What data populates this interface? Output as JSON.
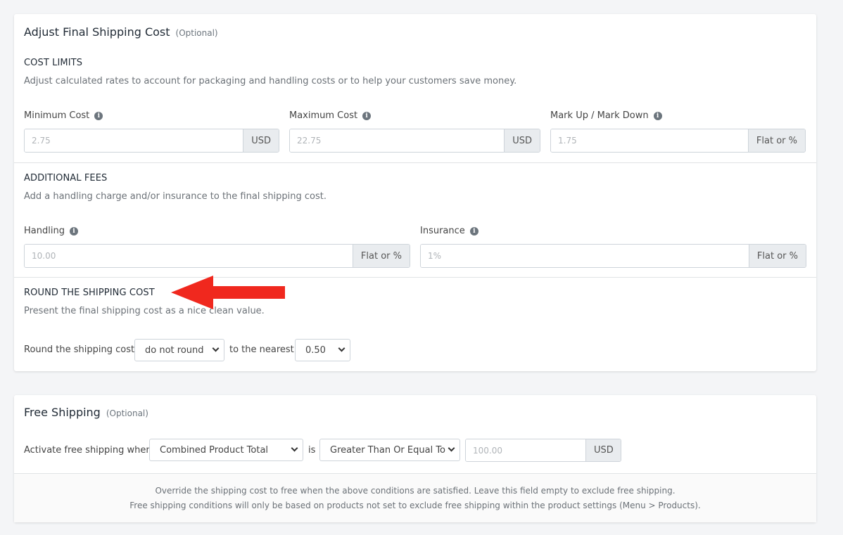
{
  "adjust": {
    "title": "Adjust Final Shipping Cost",
    "optional": "(Optional)",
    "cost_limits": {
      "heading": "COST LIMITS",
      "description": "Adjust calculated rates to account for packaging and handling costs or to help your customers save money.",
      "min": {
        "label": "Minimum Cost",
        "placeholder": "2.75",
        "addon": "USD"
      },
      "max": {
        "label": "Maximum Cost",
        "placeholder": "22.75",
        "addon": "USD"
      },
      "markup": {
        "label": "Mark Up / Mark Down",
        "placeholder": "1.75",
        "addon": "Flat or %"
      }
    },
    "fees": {
      "heading": "ADDITIONAL FEES",
      "description": "Add a handling charge and/or insurance to the final shipping cost.",
      "handling": {
        "label": "Handling",
        "placeholder": "10.00",
        "addon": "Flat or %"
      },
      "insurance": {
        "label": "Insurance",
        "placeholder": "1%",
        "addon": "Flat or %"
      }
    },
    "round": {
      "heading": "ROUND THE SHIPPING COST",
      "description": "Present the final shipping cost as a nice clean value.",
      "label": "Round the shipping cost",
      "mode": "do not round",
      "nearest_label": "to the nearest",
      "nearest": "0.50"
    }
  },
  "free": {
    "title": "Free Shipping",
    "optional": "(Optional)",
    "activate_label": "Activate free shipping when",
    "condition": "Combined Product Total",
    "is_label": "is",
    "operator": "Greater Than Or Equal To",
    "amount_placeholder": "100.00",
    "amount_addon": "USD",
    "note_line1": "Override the shipping cost to free when the above conditions are satisfied. Leave this field empty to exclude free shipping.",
    "note_line2": "Free shipping conditions will only be based on products not set to exclude free shipping within the product settings (Menu > Products)."
  },
  "colors": {
    "annotation_arrow": "#f0281e",
    "info_icon": "#6c757d"
  },
  "icons": {
    "info": "info-icon",
    "select": "chevron-down-icon",
    "annotation": "red-arrow"
  }
}
